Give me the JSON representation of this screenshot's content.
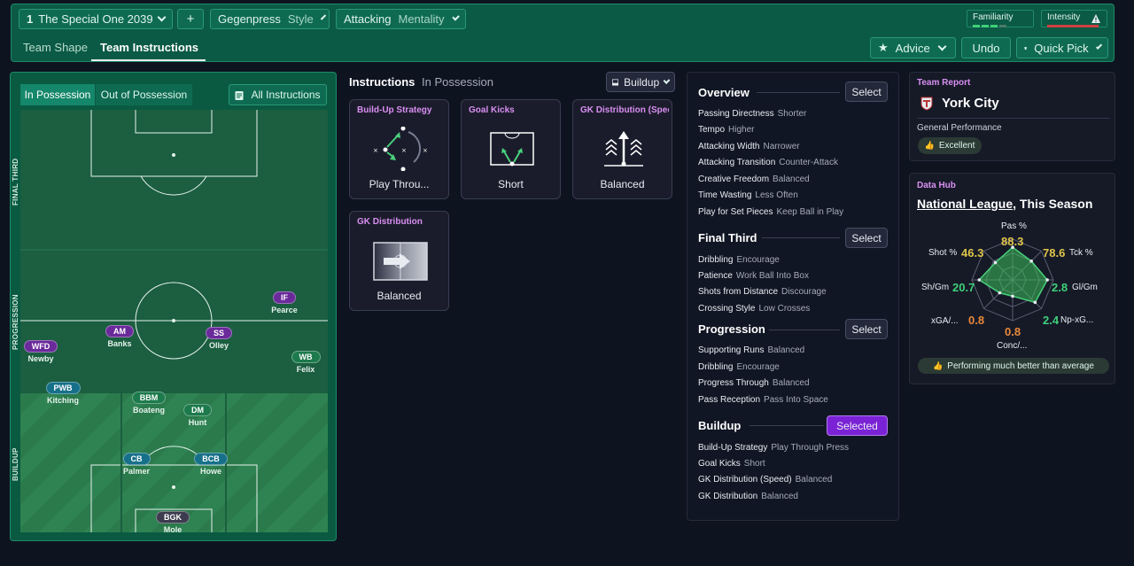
{
  "header": {
    "tactic_number": "1",
    "tactic_name": "The Special One 2039",
    "add_label": "+",
    "style_value": "Gegenpress",
    "style_label": "Style",
    "mentality_value": "Attacking",
    "mentality_label": "Mentality",
    "familiarity_label": "Familiarity",
    "intensity_label": "Intensity",
    "tabs": [
      "Team Shape",
      "Team Instructions"
    ],
    "advice_label": "Advice",
    "undo_label": "Undo",
    "quick_pick_label": "Quick Pick"
  },
  "pitch": {
    "tab_in_possession": "In Possession",
    "tab_out_of_possession": "Out of Possession",
    "all_instructions_label": "All Instructions",
    "zones": [
      "FINAL THIRD",
      "PROGRESSION",
      "BUILDUP"
    ],
    "players": [
      {
        "role": "IF",
        "name": "Pearce",
        "color": "purple"
      },
      {
        "role": "AM",
        "name": "Banks",
        "color": "purple"
      },
      {
        "role": "SS",
        "name": "Olley",
        "color": "purple"
      },
      {
        "role": "WFD",
        "name": "Newby",
        "color": "purple"
      },
      {
        "role": "WB",
        "name": "Felix",
        "color": "green"
      },
      {
        "role": "PWB",
        "name": "Kitching",
        "color": "teal"
      },
      {
        "role": "BBM",
        "name": "Boateng",
        "color": "green"
      },
      {
        "role": "DM",
        "name": "Hunt",
        "color": "green"
      },
      {
        "role": "CB",
        "name": "Palmer",
        "color": "teal"
      },
      {
        "role": "BCB",
        "name": "Howe",
        "color": "teal"
      },
      {
        "role": "BGK",
        "name": "Mole",
        "color": "gray"
      }
    ]
  },
  "instructions": {
    "title": "Instructions",
    "subtitle": "In Possession",
    "phase_select": "Buildup",
    "cards": [
      {
        "title": "Build-Up Strategy",
        "value": "Play Throu..."
      },
      {
        "title": "Goal Kicks",
        "value": "Short"
      },
      {
        "title": "GK Distribution (Speed",
        "value": "Balanced"
      },
      {
        "title": "GK Distribution",
        "value": "Balanced"
      }
    ]
  },
  "overview": {
    "sections": [
      {
        "title": "Overview",
        "button": "Select",
        "rows": [
          {
            "label": "Passing Directness",
            "value": "Shorter"
          },
          {
            "label": "Tempo",
            "value": "Higher"
          },
          {
            "label": "Attacking Width",
            "value": "Narrower"
          },
          {
            "label": "Attacking Transition",
            "value": "Counter-Attack"
          },
          {
            "label": "Creative Freedom",
            "value": "Balanced"
          },
          {
            "label": "Time Wasting",
            "value": "Less Often"
          },
          {
            "label": "Play for Set Pieces",
            "value": "Keep Ball in Play"
          }
        ]
      },
      {
        "title": "Final Third",
        "button": "Select",
        "rows": [
          {
            "label": "Dribbling",
            "value": "Encourage"
          },
          {
            "label": "Patience",
            "value": "Work Ball Into Box"
          },
          {
            "label": "Shots from Distance",
            "value": "Discourage"
          },
          {
            "label": "Crossing Style",
            "value": "Low Crosses"
          }
        ]
      },
      {
        "title": "Progression",
        "button": "Select",
        "rows": [
          {
            "label": "Supporting Runs",
            "value": "Balanced"
          },
          {
            "label": "Dribbling",
            "value": "Encourage"
          },
          {
            "label": "Progress Through",
            "value": "Balanced"
          },
          {
            "label": "Pass Reception",
            "value": "Pass Into Space"
          }
        ]
      },
      {
        "title": "Buildup",
        "button": "Selected",
        "rows": [
          {
            "label": "Build-Up Strategy",
            "value": "Play Through Press"
          },
          {
            "label": "Goal Kicks",
            "value": "Short"
          },
          {
            "label": "GK Distribution (Speed)",
            "value": "Balanced"
          },
          {
            "label": "GK Distribution",
            "value": "Balanced"
          }
        ]
      }
    ]
  },
  "team_report": {
    "heading": "Team Report",
    "team": "York City",
    "perf_label": "General Performance",
    "perf_value": "Excellent"
  },
  "data_hub": {
    "heading": "Data Hub",
    "league": "National League",
    "season": ", This Season",
    "stats": [
      {
        "label": "Pas %",
        "value": "88.3",
        "color": "#e0c54a",
        "level": 0.8
      },
      {
        "label": "Tck %",
        "value": "78.6",
        "color": "#e0c54a",
        "level": 0.65
      },
      {
        "label": "Gl/Gm",
        "value": "2.8",
        "color": "#3fd07a",
        "level": 0.85
      },
      {
        "label": "Np-xG...",
        "value": "2.4",
        "color": "#3fd07a",
        "level": 0.78
      },
      {
        "label": "Conc/...",
        "value": "0.8",
        "color": "#e8883a",
        "level": 0.4
      },
      {
        "label": "xGA/...",
        "value": "0.8",
        "color": "#e8883a",
        "level": 0.45
      },
      {
        "label": "Sh/Gm",
        "value": "20.7",
        "color": "#3fd07a",
        "level": 0.82
      },
      {
        "label": "Shot %",
        "value": "46.3",
        "color": "#e0c54a",
        "level": 0.6
      }
    ],
    "footer": "Performing much better than average"
  }
}
